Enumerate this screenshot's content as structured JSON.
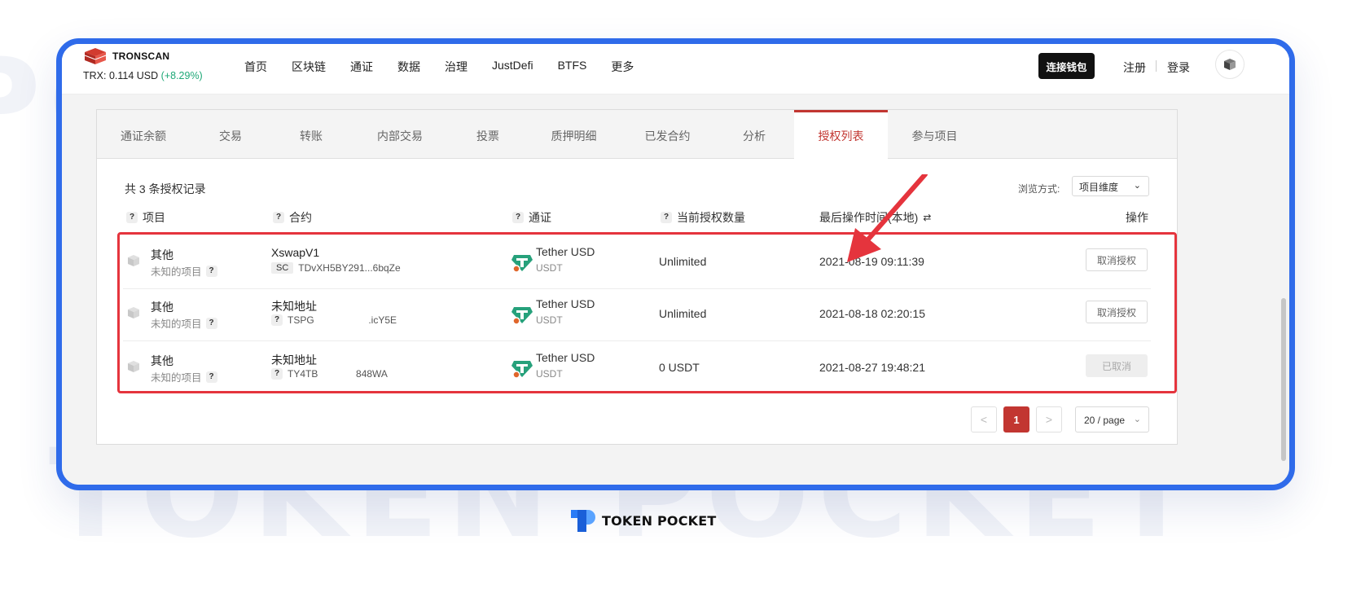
{
  "navbar": {
    "logo_text": "TRONSCAN",
    "price_label": "TRX: 0.114 USD",
    "price_change": "(+8.29%)",
    "links": [
      "首页",
      "区块链",
      "通证",
      "数据",
      "治理",
      "JustDefi",
      "BTFS",
      "更多"
    ],
    "connect_wallet": "连接钱包",
    "register": "注册",
    "login": "登录"
  },
  "tabs": [
    "通证余额",
    "交易",
    "转账",
    "内部交易",
    "投票",
    "质押明细",
    "已发合约",
    "分析",
    "授权列表",
    "参与项目"
  ],
  "active_tab": "授权列表",
  "summary": {
    "count_text": "共 3 条授权记录",
    "view_label": "浏览方式:",
    "view_value": "项目维度"
  },
  "table": {
    "headers": {
      "project": "项目",
      "contract": "合约",
      "token": "通证",
      "amount": "当前授权数量",
      "time": "最后操作时间(本地)",
      "action": "操作"
    },
    "rows": [
      {
        "project": "其他",
        "project_sub": "未知的项目",
        "contract_name": "XswapV1",
        "contract_badge": "SC",
        "contract_addr": "TDvXH5BY291...6bqZe",
        "token_name": "Tether USD",
        "token_symbol": "USDT",
        "amount": "Unlimited",
        "time": "2021-08-19 09:11:39",
        "action": "取消授权",
        "action_disabled": false
      },
      {
        "project": "其他",
        "project_sub": "未知的项目",
        "contract_name": "未知地址",
        "contract_badge": "?",
        "contract_addr": "TSPG                    .icY5E",
        "token_name": "Tether USD",
        "token_symbol": "USDT",
        "amount": "Unlimited",
        "time": "2021-08-18 02:20:15",
        "action": "取消授权",
        "action_disabled": false
      },
      {
        "project": "其他",
        "project_sub": "未知的项目",
        "contract_name": "未知地址",
        "contract_badge": "?",
        "contract_addr": "TY4TB              848WA",
        "token_name": "Tether USD",
        "token_symbol": "USDT",
        "amount": "0 USDT",
        "time": "2021-08-27 19:48:21",
        "action": "已取消",
        "action_disabled": true
      }
    ]
  },
  "pagination": {
    "prev": "<",
    "current": "1",
    "next": ">",
    "page_size": "20 / page"
  },
  "footer_brand": "TOKEN POCKET",
  "colors": {
    "frame_blue": "#2f6bea",
    "active_red": "#c23631",
    "highlight_red": "#e5343d",
    "tether_green": "#26a17b"
  }
}
